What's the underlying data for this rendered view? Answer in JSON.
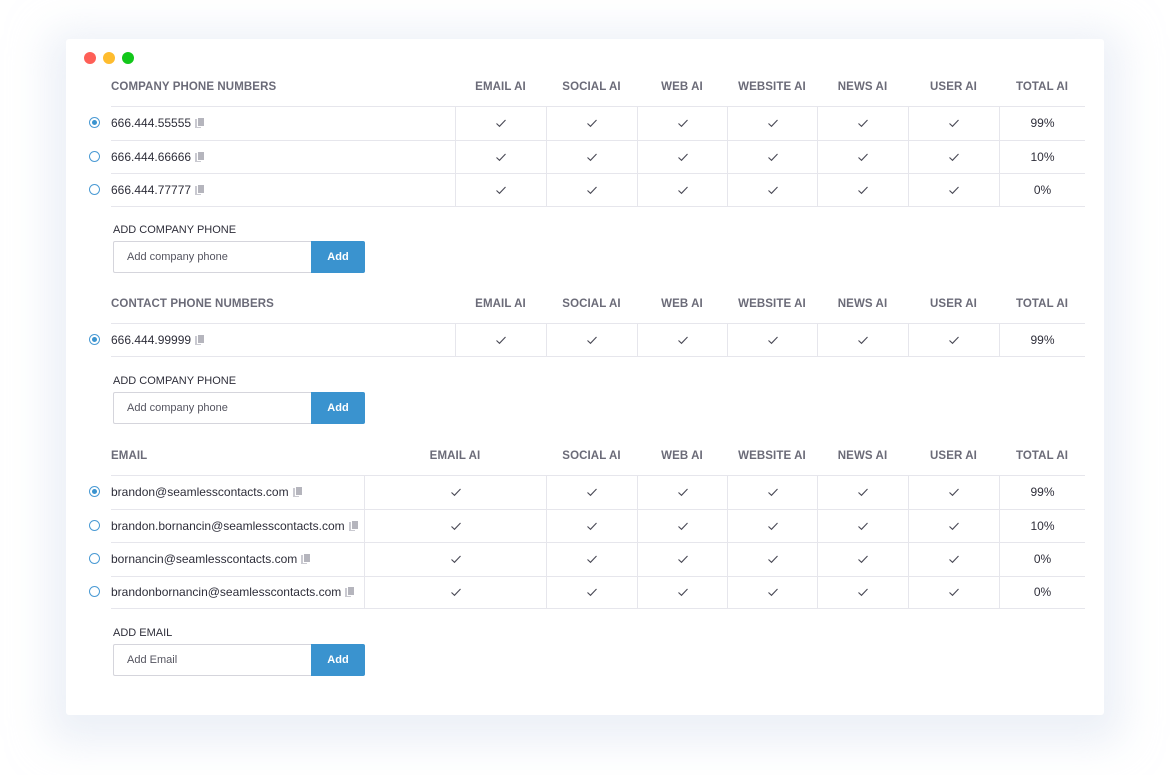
{
  "window": {
    "controls": [
      "close",
      "minimize",
      "maximize"
    ]
  },
  "columns": [
    "EMAIL AI",
    "SOCIAL AI",
    "WEB AI",
    "WEBSITE AI",
    "NEWS AI",
    "USER AI",
    "TOTAL AI"
  ],
  "company_phones": {
    "title": "COMPANY PHONE NUMBERS",
    "rows": [
      {
        "value": "666.444.55555",
        "selected": true,
        "checks": [
          true,
          true,
          true,
          true,
          true,
          true
        ],
        "total": "99%"
      },
      {
        "value": "666.444.66666",
        "selected": false,
        "checks": [
          true,
          true,
          true,
          true,
          true,
          true
        ],
        "total": "10%"
      },
      {
        "value": "666.444.77777",
        "selected": false,
        "checks": [
          true,
          true,
          true,
          true,
          true,
          true
        ],
        "total": "0%"
      }
    ],
    "add": {
      "label": "ADD COMPANY PHONE",
      "placeholder": "Add company phone",
      "button": "Add"
    }
  },
  "contact_phones": {
    "title": "CONTACT PHONE NUMBERS",
    "rows": [
      {
        "value": "666.444.99999",
        "selected": true,
        "checks": [
          true,
          true,
          true,
          true,
          true,
          true
        ],
        "total": "99%"
      }
    ],
    "add": {
      "label": "ADD COMPANY PHONE",
      "placeholder": "Add company phone",
      "button": "Add"
    }
  },
  "emails": {
    "title": "EMAIL",
    "rows": [
      {
        "value": "brandon@seamlesscontacts.com",
        "selected": true,
        "checks": [
          true,
          true,
          true,
          true,
          true,
          true
        ],
        "total": "99%"
      },
      {
        "value": "brandon.bornancin@seamlesscontacts.com",
        "selected": false,
        "checks": [
          true,
          true,
          true,
          true,
          true,
          true
        ],
        "total": "10%"
      },
      {
        "value": "bornancin@seamlesscontacts.com",
        "selected": false,
        "checks": [
          true,
          true,
          true,
          true,
          true,
          true
        ],
        "total": "0%"
      },
      {
        "value": "brandonbornancin@seamlesscontacts.com",
        "selected": false,
        "checks": [
          true,
          true,
          true,
          true,
          true,
          true
        ],
        "total": "0%"
      }
    ],
    "add": {
      "label": "ADD EMAIL",
      "placeholder": "Add Email",
      "button": "Add"
    }
  },
  "colors": {
    "accent": "#3a93cf",
    "header_text": "#6b6b78",
    "border": "#e6e6ec"
  }
}
